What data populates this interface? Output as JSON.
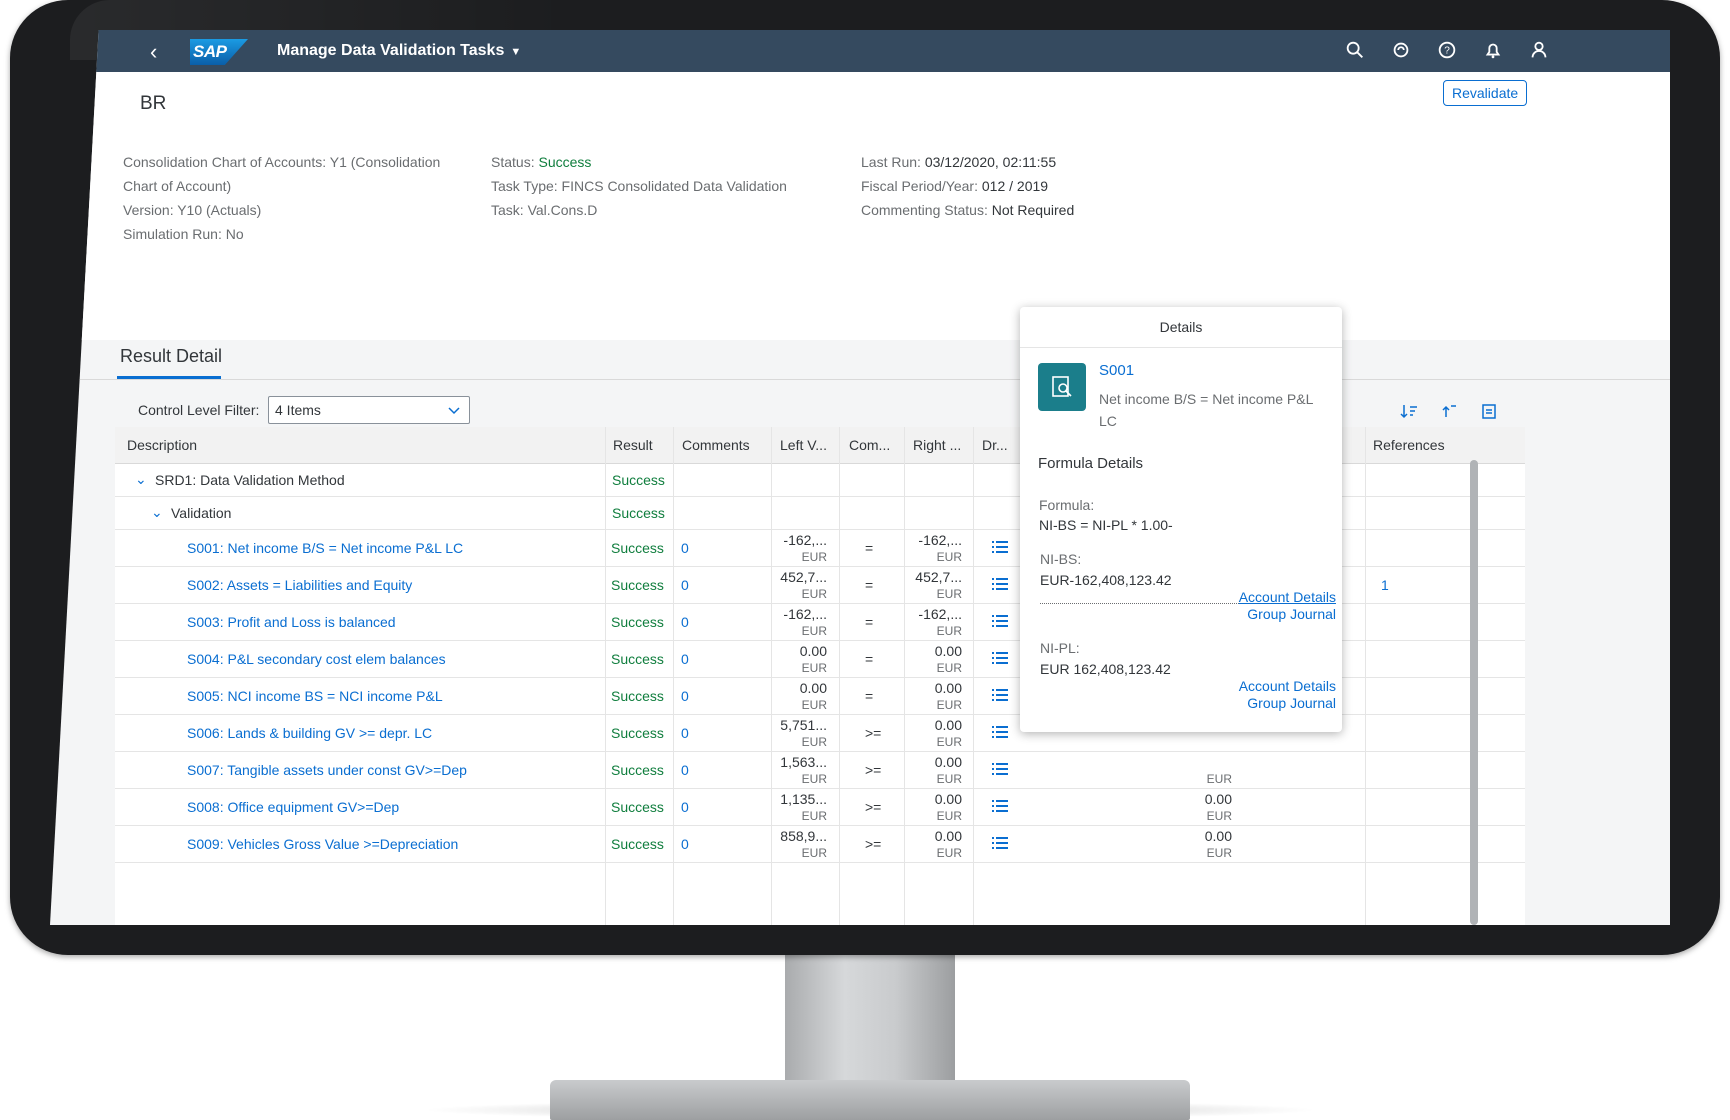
{
  "shell": {
    "logo_text": "SAP",
    "app_title": "Manage Data Validation Tasks",
    "accent": "#354a5f"
  },
  "header": {
    "object_title": "BR",
    "revalidate_label": "Revalidate",
    "col1": {
      "chart_of_accounts": "Consolidation Chart of Accounts: Y1 (Consolidation",
      "chart_of_accounts_2": "Chart of Account)",
      "version": "Version: Y10 (Actuals)",
      "simulation_run": "Simulation Run: No"
    },
    "col2": {
      "status_label": "Status:",
      "status_value": "Success",
      "task_type": "Task Type: FINCS Consolidated Data Validation",
      "task": "Task: Val.Cons.D"
    },
    "col3": {
      "last_run_label": "Last Run:",
      "last_run_value": "03/12/2020, 02:11:55",
      "fiscal_label": "Fiscal Period/Year:",
      "fiscal_value": "012 / 2019",
      "commenting_label": "Commenting Status:",
      "commenting_value": "Not Required"
    }
  },
  "result_detail": {
    "tab_label": "Result Detail",
    "filter_label": "Control Level Filter:",
    "filter_value": "4 Items",
    "columns": [
      "Description",
      "Result",
      "Comments",
      "Left V...",
      "Com...",
      "Right ...",
      "Dr...",
      "References"
    ],
    "group_rows": [
      {
        "label": "SRD1: Data Validation Method",
        "result": "Success"
      },
      {
        "label": "Validation",
        "result": "Success"
      }
    ],
    "rows": [
      {
        "desc": "S001: Net income B/S = Net income P&L LC",
        "result": "Success",
        "comments": "0",
        "left": "-162,...",
        "left_unit": "EUR",
        "op": "=",
        "right": "-162,...",
        "right_unit": "EUR",
        "ref": ""
      },
      {
        "desc": "S002: Assets = Liabilities and Equity",
        "result": "Success",
        "comments": "0",
        "left": "452,7...",
        "left_unit": "EUR",
        "op": "=",
        "right": "452,7...",
        "right_unit": "EUR",
        "ref": "1"
      },
      {
        "desc": "S003: Profit and Loss is balanced",
        "result": "Success",
        "comments": "0",
        "left": "-162,...",
        "left_unit": "EUR",
        "op": "=",
        "right": "-162,...",
        "right_unit": "EUR",
        "ref": ""
      },
      {
        "desc": "S004: P&L secondary cost elem balances",
        "result": "Success",
        "comments": "0",
        "left": "0.00",
        "left_unit": "EUR",
        "op": "=",
        "right": "0.00",
        "right_unit": "EUR",
        "ref": ""
      },
      {
        "desc": "S005: NCI income BS = NCI income P&L",
        "result": "Success",
        "comments": "0",
        "left": "0.00",
        "left_unit": "EUR",
        "op": "=",
        "right": "0.00",
        "right_unit": "EUR",
        "ref": ""
      },
      {
        "desc": "S006: Lands & building GV >= depr. LC",
        "result": "Success",
        "comments": "0",
        "left": "5,751...",
        "left_unit": "EUR",
        "op": ">=",
        "right": "0.00",
        "right_unit": "EUR",
        "ref": ""
      },
      {
        "desc": "S007: Tangible assets under const GV>=Dep",
        "result": "Success",
        "comments": "0",
        "left": "1,563...",
        "left_unit": "EUR",
        "op": ">=",
        "right": "0.00",
        "right_unit": "EUR",
        "ref": ""
      },
      {
        "desc": "S008: Office equipment GV>=Dep",
        "result": "Success",
        "comments": "0",
        "left": "1,135...",
        "left_unit": "EUR",
        "op": ">=",
        "right": "0.00",
        "right_unit": "EUR",
        "ref": ""
      },
      {
        "desc": "S009: Vehicles Gross Value >=Depreciation",
        "result": "Success",
        "comments": "0",
        "left": "858,9...",
        "left_unit": "EUR",
        "op": ">=",
        "right": "0.00",
        "right_unit": "EUR",
        "ref": ""
      }
    ],
    "hidden_col_values": [
      {
        "value": "",
        "unit": "EUR"
      },
      {
        "value": "0.00",
        "unit": "EUR"
      },
      {
        "value": "0.00",
        "unit": "EUR"
      }
    ]
  },
  "popover": {
    "title": "Details",
    "id": "S001",
    "description": "Net income B/S = Net income P&L LC",
    "section": "Formula Details",
    "formula_label": "Formula:",
    "formula_value": "NI-BS = NI-PL * 1.00-",
    "nibs_label": "NI-BS:",
    "nibs_value": "EUR-162,408,123.42",
    "nipl_label": "NI-PL:",
    "nipl_value": "EUR 162,408,123.42",
    "account_details": "Account Details",
    "group_journal": "Group Journal"
  }
}
